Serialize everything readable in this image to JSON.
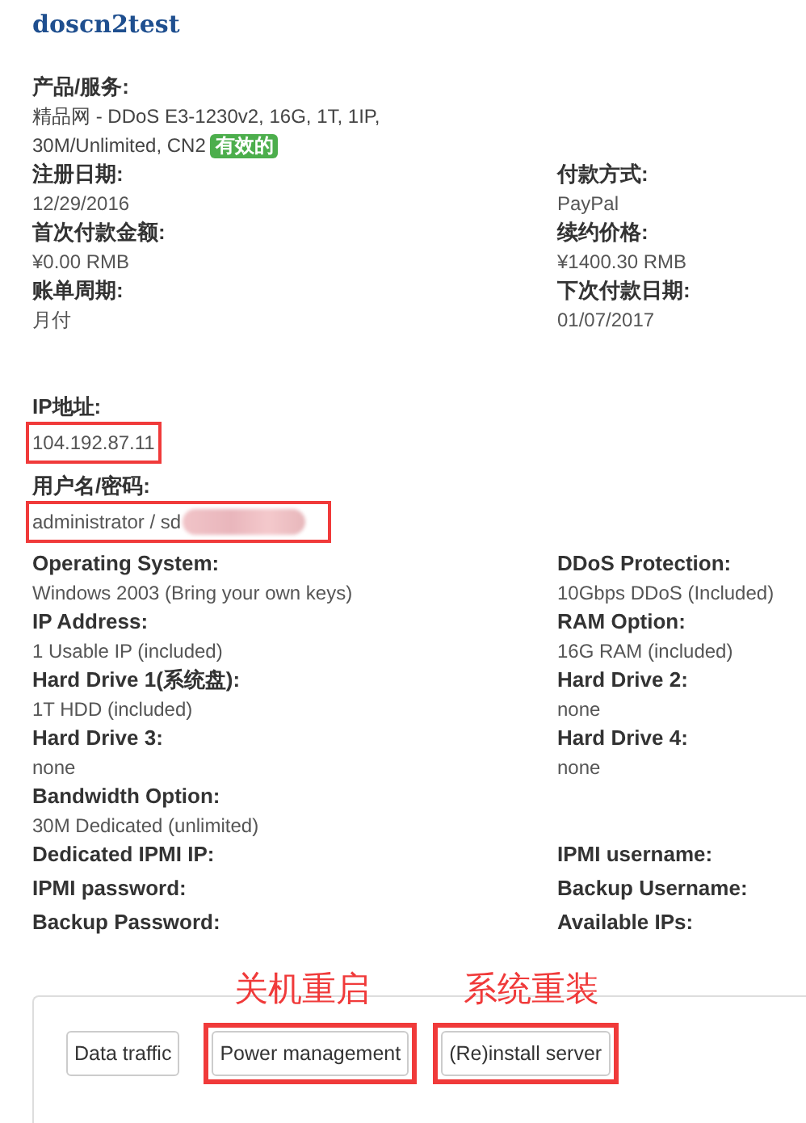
{
  "title": "doscn2test",
  "product": {
    "label": "产品/服务:",
    "value_lines": [
      "精品网 - DDoS E3-1230v2, 16G, 1T, 1IP,",
      "30M/Unlimited, CN2"
    ],
    "status": "有效的"
  },
  "billing": [
    {
      "left": {
        "label": "注册日期:",
        "value": "12/29/2016"
      },
      "right": {
        "label": "付款方式:",
        "value": "PayPal"
      }
    },
    {
      "left": {
        "label": "首次付款金额:",
        "value": "¥0.00 RMB"
      },
      "right": {
        "label": "续约价格:",
        "value": "¥1400.30 RMB"
      }
    },
    {
      "left": {
        "label": "账单周期:",
        "value": "月付"
      },
      "right": {
        "label": "下次付款日期:",
        "value": "01/07/2017"
      }
    }
  ],
  "access": [
    {
      "label": "IP地址:",
      "value": "104.192.87.11",
      "redacted": false,
      "highlighted": true
    },
    {
      "label": "用户名/密码:",
      "value": "administrator / sd",
      "redacted": true,
      "highlighted": true
    }
  ],
  "options": [
    {
      "left": {
        "label": "Operating System:",
        "value": "Windows 2003 (Bring your own keys)"
      },
      "right": {
        "label": "DDoS Protection:",
        "value": "10Gbps DDoS (Included)"
      }
    },
    {
      "left": {
        "label": "IP Address:",
        "value": "1 Usable IP (included)"
      },
      "right": {
        "label": "RAM Option:",
        "value": "16G RAM (included)"
      }
    },
    {
      "left": {
        "label": "Hard Drive 1(系统盘):",
        "value": "1T HDD (included)"
      },
      "right": {
        "label": "Hard Drive 2:",
        "value": "none"
      }
    },
    {
      "left": {
        "label": "Hard Drive 3:",
        "value": "none"
      },
      "right": {
        "label": "Hard Drive 4:",
        "value": "none"
      }
    },
    {
      "left": {
        "label": "Bandwidth Option:",
        "value": "30M Dedicated (unlimited)"
      }
    },
    {
      "left": {
        "label": "Dedicated IPMI IP:"
      },
      "right": {
        "label": "IPMI username:"
      }
    },
    {
      "left": {
        "label": "IPMI password:"
      },
      "right": {
        "label": "Backup Username:"
      }
    },
    {
      "left": {
        "label": "Backup Password:"
      },
      "right": {
        "label": "Available IPs:"
      }
    }
  ],
  "buttons": [
    {
      "label": "Data traffic",
      "highlighted": false
    },
    {
      "label": "Power management",
      "highlighted": true,
      "note": "关机重启"
    },
    {
      "label": "(Re)install server",
      "highlighted": true,
      "note": "系统重装"
    }
  ]
}
